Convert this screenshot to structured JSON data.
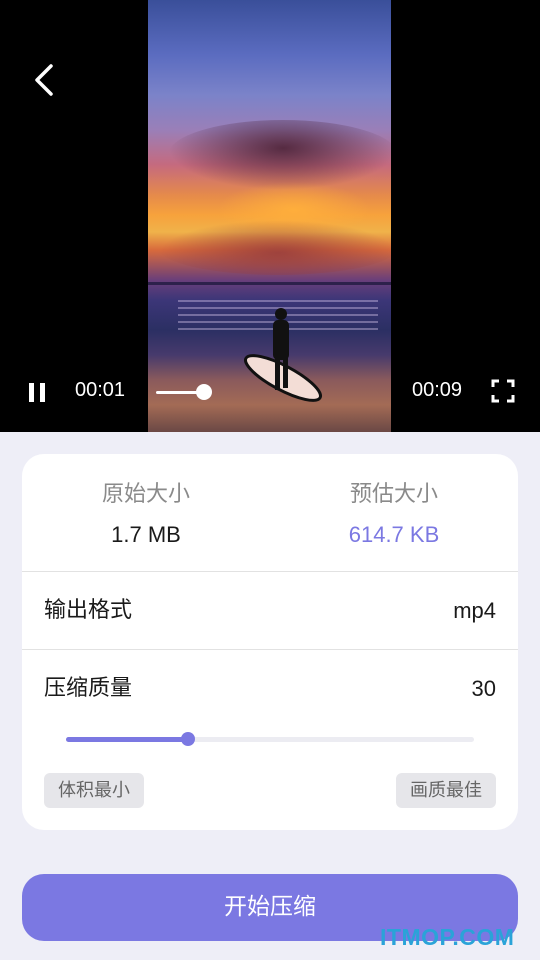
{
  "player": {
    "current_time": "00:01",
    "total_time": "00:09",
    "progress_fraction": 0.2,
    "state": "playing"
  },
  "sizes": {
    "original_label": "原始大小",
    "original_value": "1.7 MB",
    "estimated_label": "预估大小",
    "estimated_value": "614.7 KB"
  },
  "format": {
    "label": "输出格式",
    "value": "mp4"
  },
  "quality": {
    "label": "压缩质量",
    "value": "30",
    "slider_fraction": 0.3,
    "min_label": "体积最小",
    "max_label": "画质最佳"
  },
  "start_button": "开始压缩",
  "watermark": "ITMOP.COM",
  "colors": {
    "accent": "#7b78e2",
    "background": "#eeeef7",
    "watermark": "#2aa3d8"
  },
  "icons": {
    "back": "chevron-left-icon",
    "pause": "pause-icon",
    "fullscreen": "fullscreen-icon"
  }
}
